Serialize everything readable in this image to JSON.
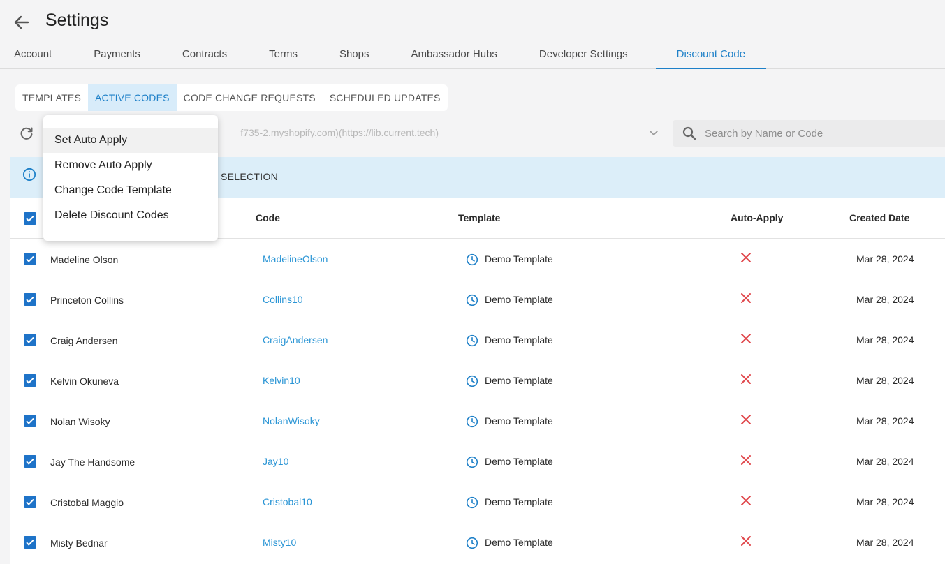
{
  "header": {
    "title": "Settings",
    "tabs": [
      "Account",
      "Payments",
      "Contracts",
      "Terms",
      "Shops",
      "Ambassador Hubs",
      "Developer Settings",
      "Discount Code"
    ],
    "active_tab": "Discount Code"
  },
  "subtabs": {
    "items": [
      "TEMPLATES",
      "ACTIVE CODES",
      "CODE CHANGE REQUESTS",
      "SCHEDULED UPDATES"
    ],
    "active": "ACTIVE CODES"
  },
  "toolbar": {
    "shop_select_value": "f735-2.myshopify.com)(https://lib.current.tech)",
    "search_placeholder": "Search by Name or Code"
  },
  "info_bar": {
    "text": "SELECTION"
  },
  "bulk_menu": {
    "items": [
      "Set Auto Apply",
      "Remove Auto Apply",
      "Change Code Template",
      "Delete Discount Codes"
    ],
    "highlighted": "Set Auto Apply"
  },
  "table": {
    "columns": [
      "Code",
      "Template",
      "Auto-Apply",
      "Created Date"
    ],
    "rows": [
      {
        "name": "Madeline Olson",
        "code": "MadelineOlson",
        "template": "Demo Template",
        "auto_apply": false,
        "created": "Mar 28, 2024",
        "selected": true
      },
      {
        "name": "Princeton Collins",
        "code": "Collins10",
        "template": "Demo Template",
        "auto_apply": false,
        "created": "Mar 28, 2024",
        "selected": true
      },
      {
        "name": "Craig Andersen",
        "code": "CraigAndersen",
        "template": "Demo Template",
        "auto_apply": false,
        "created": "Mar 28, 2024",
        "selected": true
      },
      {
        "name": "Kelvin Okuneva",
        "code": "Kelvin10",
        "template": "Demo Template",
        "auto_apply": false,
        "created": "Mar 28, 2024",
        "selected": true
      },
      {
        "name": "Nolan Wisoky",
        "code": "NolanWisoky",
        "template": "Demo Template",
        "auto_apply": false,
        "created": "Mar 28, 2024",
        "selected": true
      },
      {
        "name": "Jay The Handsome",
        "code": "Jay10",
        "template": "Demo Template",
        "auto_apply": false,
        "created": "Mar 28, 2024",
        "selected": true
      },
      {
        "name": "Cristobal Maggio",
        "code": "Cristobal10",
        "template": "Demo Template",
        "auto_apply": false,
        "created": "Mar 28, 2024",
        "selected": true
      },
      {
        "name": "Misty Bednar",
        "code": "Misty10",
        "template": "Demo Template",
        "auto_apply": false,
        "created": "Mar 28, 2024",
        "selected": true
      }
    ]
  },
  "colors": {
    "accent": "#1e80c8",
    "link": "#2a95d5",
    "checkbox": "#1e73c8",
    "x_mark": "#e0474c",
    "info_bg": "#dceef9"
  }
}
